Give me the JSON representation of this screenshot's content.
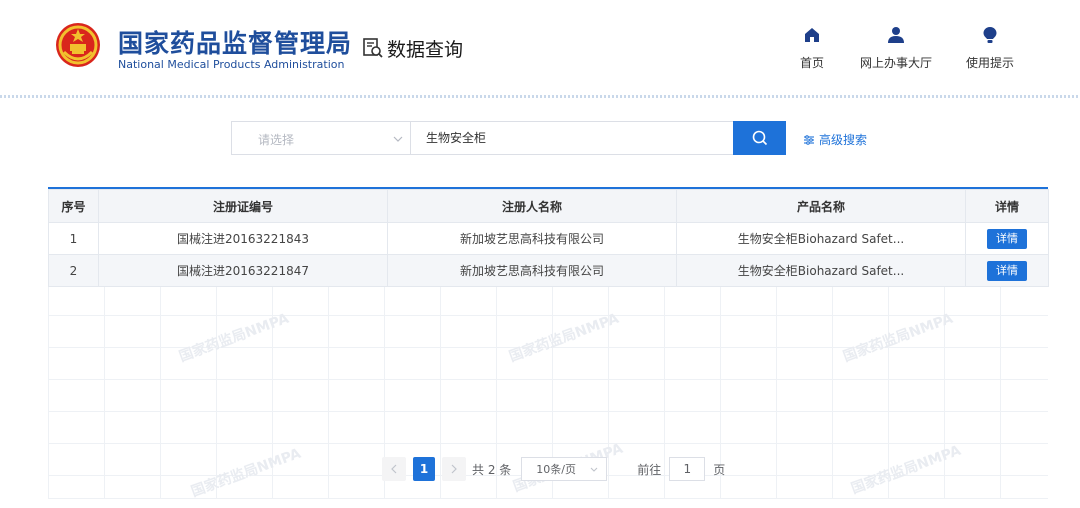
{
  "header": {
    "org_name_cn": "国家药品监督管理局",
    "org_name_en": "National Medical Products Administration",
    "module_title": "数据查询",
    "nav": [
      {
        "label": "首页",
        "icon": "home-icon"
      },
      {
        "label": "网上办事大厅",
        "icon": "person-icon"
      },
      {
        "label": "使用提示",
        "icon": "lightbulb-icon"
      }
    ]
  },
  "search": {
    "select_placeholder": "请选择",
    "query": "生物安全柜",
    "advanced_label": "高级搜索"
  },
  "table": {
    "columns": [
      "序号",
      "注册证编号",
      "注册人名称",
      "产品名称",
      "详情"
    ],
    "rows": [
      {
        "index": "1",
        "reg_no": "国械注进20163221843",
        "registrant": "新加坡艺思高科技有限公司",
        "product": "生物安全柜Biohazard Safet...",
        "action": "详情"
      },
      {
        "index": "2",
        "reg_no": "国械注进20163221847",
        "registrant": "新加坡艺思高科技有限公司",
        "product": "生物安全柜Biohazard Safet...",
        "action": "详情"
      }
    ]
  },
  "watermark": "国家药监局NMPA",
  "pagination": {
    "current_page": "1",
    "total": "共 2 条",
    "page_size": "10条/页",
    "goto_label": "前往",
    "goto_value": "1",
    "page_suffix": "页"
  },
  "colors": {
    "brand": "#1f4e9c",
    "accent": "#1e72d9"
  }
}
